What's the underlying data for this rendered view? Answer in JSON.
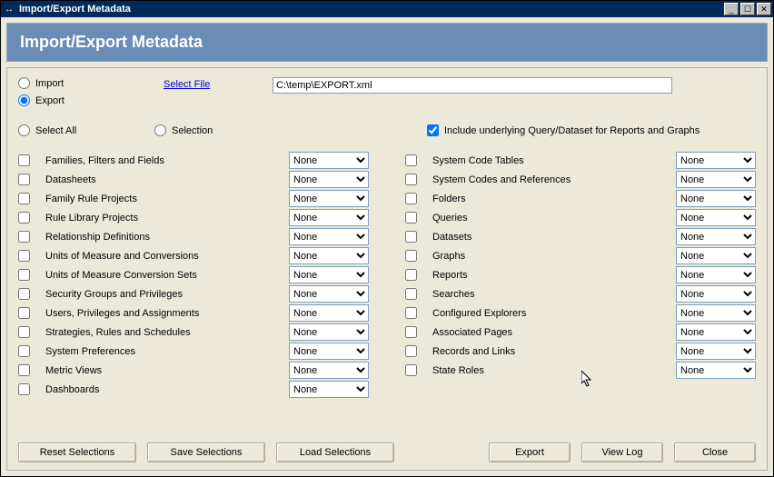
{
  "window": {
    "title": "Import/Export Metadata"
  },
  "header": {
    "title": "Import/Export Metadata"
  },
  "mode": {
    "import_label": "Import",
    "export_label": "Export",
    "selected": "export"
  },
  "file": {
    "link_label": "Select File",
    "path": "C:\\temp\\EXPORT.xml"
  },
  "scope": {
    "select_all_label": "Select All",
    "selection_label": "Selection",
    "include_underlying_label": "Include underlying Query/Dataset for Reports and Graphs",
    "include_underlying_checked": true
  },
  "dropdown_value": "None",
  "left_items": [
    {
      "label": "Families, Filters and Fields",
      "checked": false,
      "value": "None"
    },
    {
      "label": "Datasheets",
      "checked": false,
      "value": "None"
    },
    {
      "label": "Family Rule Projects",
      "checked": false,
      "value": "None"
    },
    {
      "label": "Rule Library Projects",
      "checked": false,
      "value": "None"
    },
    {
      "label": "Relationship Definitions",
      "checked": false,
      "value": "None"
    },
    {
      "label": "Units of Measure and Conversions",
      "checked": false,
      "value": "None"
    },
    {
      "label": "Units of Measure Conversion Sets",
      "checked": false,
      "value": "None"
    },
    {
      "label": "Security Groups and Privileges",
      "checked": false,
      "value": "None"
    },
    {
      "label": "Users, Privileges and Assignments",
      "checked": false,
      "value": "None"
    },
    {
      "label": "Strategies, Rules and Schedules",
      "checked": false,
      "value": "None"
    },
    {
      "label": "System Preferences",
      "checked": false,
      "value": "None"
    },
    {
      "label": "Metric Views",
      "checked": false,
      "value": "None"
    },
    {
      "label": "Dashboards",
      "checked": false,
      "value": "None"
    }
  ],
  "right_items": [
    {
      "label": "System Code Tables",
      "checked": false,
      "value": "None"
    },
    {
      "label": "System Codes and References",
      "checked": false,
      "value": "None"
    },
    {
      "label": "Folders",
      "checked": false,
      "value": "None"
    },
    {
      "label": "Queries",
      "checked": false,
      "value": "None"
    },
    {
      "label": "Datasets",
      "checked": false,
      "value": "None"
    },
    {
      "label": "Graphs",
      "checked": false,
      "value": "None"
    },
    {
      "label": "Reports",
      "checked": false,
      "value": "None"
    },
    {
      "label": "Searches",
      "checked": false,
      "value": "None"
    },
    {
      "label": "Configured Explorers",
      "checked": false,
      "value": "None"
    },
    {
      "label": "Associated Pages",
      "checked": false,
      "value": "None"
    },
    {
      "label": "Records and Links",
      "checked": false,
      "value": "None"
    },
    {
      "label": "State Roles",
      "checked": false,
      "value": "None"
    }
  ],
  "buttons": {
    "reset": "Reset Selections",
    "save": "Save Selections",
    "load": "Load Selections",
    "export": "Export",
    "viewlog": "View Log",
    "close": "Close"
  }
}
